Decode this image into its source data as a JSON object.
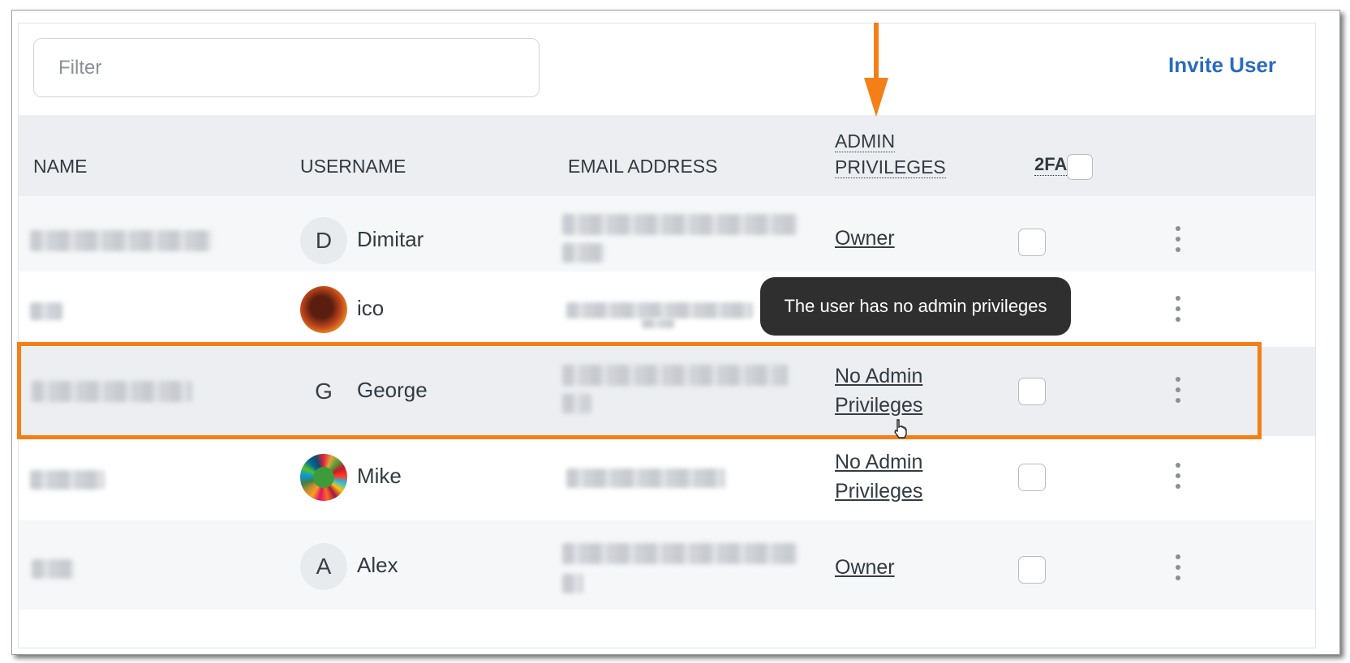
{
  "filter": {
    "placeholder": "Filter"
  },
  "actions": {
    "invite_label": "Invite User"
  },
  "columns": {
    "name": "NAME",
    "username": "USERNAME",
    "email": "EMAIL ADDRESS",
    "admin_line1": "ADMIN",
    "admin_line2": "PRIVILEGES",
    "twofa": "2FA"
  },
  "rows": [
    {
      "name": "(redacted)",
      "avatar_letter": "D",
      "username": "Dimitar",
      "email": "(redacted)",
      "admin_line1": "Owner",
      "admin_line2": "",
      "twofa_checked": false
    },
    {
      "name": "(redacted)",
      "avatar_letter": "",
      "avatar_icon": "planet-image-avatar",
      "username": "ico",
      "email": "(redacted)",
      "admin_line1": "",
      "admin_line2": "",
      "twofa_checked": false
    },
    {
      "name": "(redacted)",
      "avatar_letter": "G",
      "username": "George",
      "email": "(redacted)",
      "admin_line1": "No Admin",
      "admin_line2": "Privileges",
      "twofa_checked": false
    },
    {
      "name": "(redacted)",
      "avatar_letter": "",
      "avatar_icon": "colorful-wheel-image-avatar",
      "username": "Mike",
      "email": "(redacted)",
      "admin_line1": "No Admin",
      "admin_line2": "Privileges",
      "twofa_checked": false
    },
    {
      "name": "(redacted)",
      "avatar_letter": "A",
      "username": "Alex",
      "email": "(redacted)",
      "admin_line1": "Owner",
      "admin_line2": "",
      "twofa_checked": false
    }
  ],
  "tooltip": {
    "text": "The user has no admin privileges"
  },
  "annotations": {
    "highlight_color": "#f57f17",
    "arrow_color": "#f57f17"
  },
  "colors": {
    "accent": "#2a6bbf",
    "header_bg": "#eceef1",
    "tooltip_bg": "#2f2f2f"
  }
}
